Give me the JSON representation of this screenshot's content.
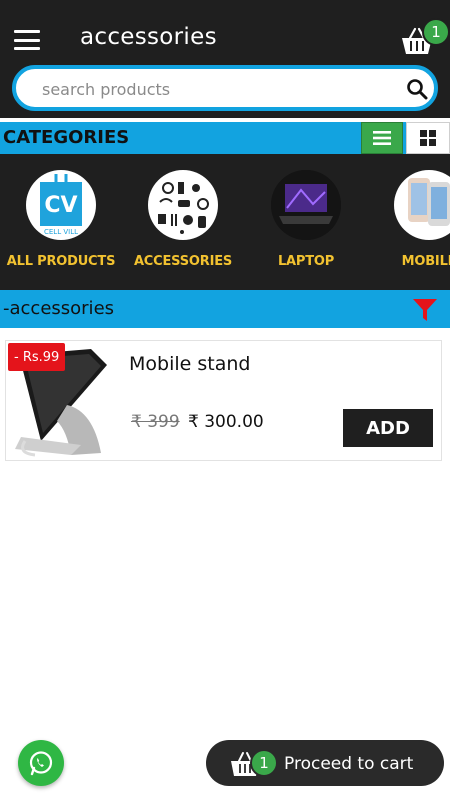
{
  "header": {
    "title": "accessories",
    "cart_count": "1"
  },
  "search": {
    "placeholder": "search products",
    "value": ""
  },
  "categories": {
    "heading": "CATEGORIES",
    "items": [
      {
        "label": "ALL PRODUCTS",
        "logo_text": "CV",
        "logo_sub": "CELL VILL"
      },
      {
        "label": "ACCESSORIES"
      },
      {
        "label": "LAPTOP"
      },
      {
        "label": "MOBILE"
      }
    ]
  },
  "section": {
    "title": "-accessories"
  },
  "products": [
    {
      "name": "Mobile stand",
      "discount": "- Rs.99",
      "old_price": "₹ 399",
      "price": "₹ 300.00",
      "add_label": "ADD"
    }
  ],
  "footer": {
    "cart_count": "1",
    "proceed_label": "Proceed to cart"
  },
  "colors": {
    "dark": "#1f1f1f",
    "accent_blue": "#12a3e0",
    "green": "#3aa84a",
    "category_label": "#f2c230",
    "discount_red": "#e4141b",
    "whatsapp_green": "#2fb744"
  },
  "icons": [
    "menu-icon",
    "basket-icon",
    "search-icon",
    "list-view-icon",
    "grid-view-icon",
    "filter-icon",
    "whatsapp-icon"
  ]
}
